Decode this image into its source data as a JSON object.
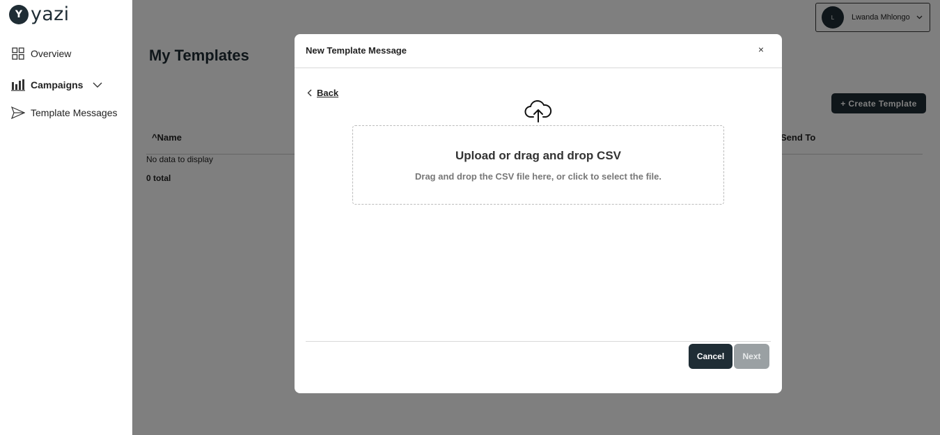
{
  "app": {
    "brand": "yazi",
    "brand_mark": "Y"
  },
  "sidebar": {
    "items": [
      {
        "label": "Overview",
        "icon": "grid-icon"
      },
      {
        "label": "Campaigns",
        "icon": "bar-chart-icon"
      },
      {
        "label": "Template Messages",
        "icon": "send-icon"
      }
    ]
  },
  "header": {
    "user_initial": "L",
    "user_name": "Lwanda Mhlongo"
  },
  "main": {
    "title": "My Templates",
    "create_button": "+ Create Template",
    "table": {
      "columns": [
        "Name",
        "Send To"
      ],
      "sort_indicator": "^",
      "empty_text": "No data to display",
      "total_text": "0 total"
    }
  },
  "modal": {
    "title": "New Template Message",
    "close_label": "×",
    "back_label": "Back",
    "dropzone": {
      "title": "Upload or drag and drop CSV",
      "subtitle": "Drag and drop the CSV file here, or click to select the file."
    },
    "cancel_label": "Cancel",
    "next_label": "Next"
  },
  "colors": {
    "brand_dark": "#1f2d35",
    "overlay": "rgba(0,0,0,0.5)",
    "disabled": "#9aa0a3"
  }
}
